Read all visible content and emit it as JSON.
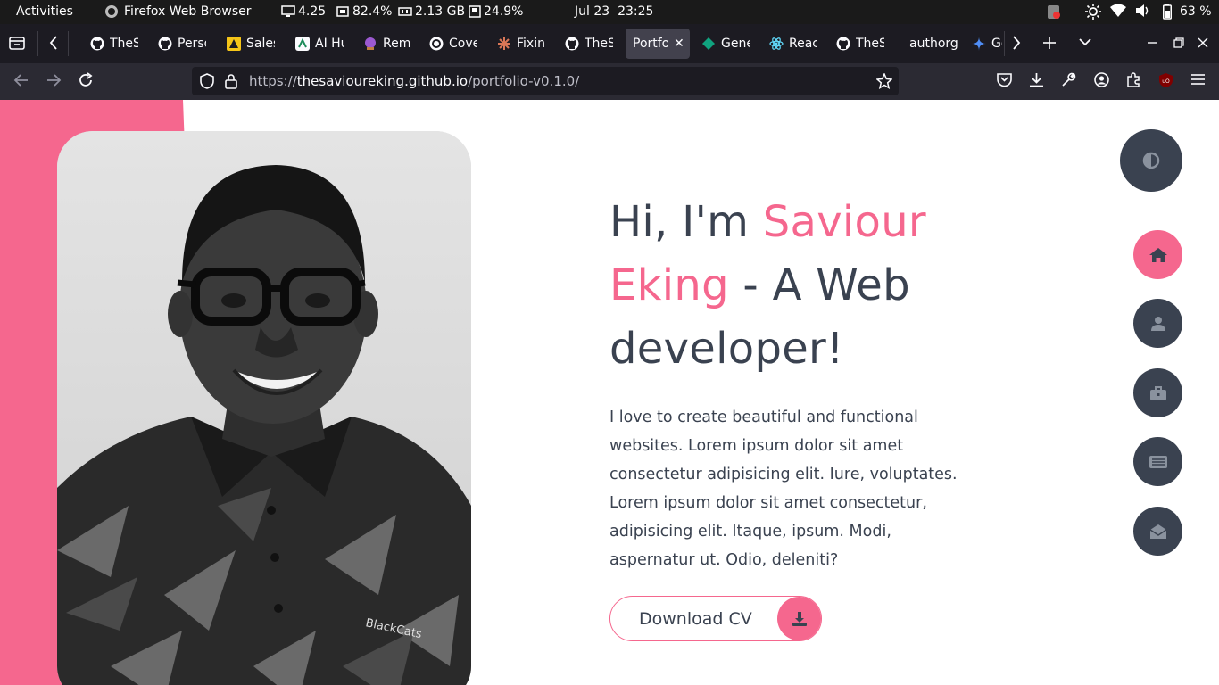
{
  "topbar": {
    "activities": "Activities",
    "app_name": "Firefox Web Browser",
    "load": "4.25",
    "cpu": "82.4%",
    "mem": "2.13 GB",
    "disk": "24.9%",
    "date": "Jul 23",
    "time": "23:25",
    "battery": "63 %"
  },
  "tabs": [
    {
      "label": "TheS",
      "icon": "github-icon"
    },
    {
      "label": "Perso",
      "icon": "github-icon"
    },
    {
      "label": "Sales",
      "icon": "app-icon"
    },
    {
      "label": "AI Hu",
      "icon": "ai-icon"
    },
    {
      "label": "Rem",
      "icon": "crystal-ball-icon"
    },
    {
      "label": "Cove",
      "icon": "openai-icon"
    },
    {
      "label": "Fixin",
      "icon": "claude-icon"
    },
    {
      "label": "TheS",
      "icon": "github-icon"
    },
    {
      "label": "Portfo",
      "icon": "none",
      "active": true
    },
    {
      "label": "Gene",
      "icon": "diamond-icon"
    },
    {
      "label": "Reac",
      "icon": "react-icon"
    },
    {
      "label": "TheS",
      "icon": "github-icon"
    },
    {
      "label": "authorg",
      "icon": "none"
    },
    {
      "label": "Ge",
      "icon": "gemini-icon"
    }
  ],
  "url": {
    "prefix": "https://",
    "host": "thesavioureking.github.io",
    "path": "/portfolio-v0.1.0/"
  },
  "hero": {
    "greeting": "Hi, I'm ",
    "name_part1": "Saviour",
    "name_part2": "Eking",
    "rest": " - A Web developer!",
    "bio": "I love to create beautiful and functional websites. Lorem ipsum dolor sit amet consectetur adipisicing elit. Iure, voluptates. Lorem ipsum dolor sit amet consectetur, adipisicing elit. Itaque, ipsum. Modi, aspernatur ut. Odio, deleniti?",
    "cta": "Download CV",
    "shirt_text": "BlackCats"
  },
  "colors": {
    "accent": "#f5678e",
    "dark": "#3a4250"
  },
  "side_nav": [
    "home-icon",
    "user-icon",
    "briefcase-icon",
    "newspaper-icon",
    "envelope-icon"
  ]
}
